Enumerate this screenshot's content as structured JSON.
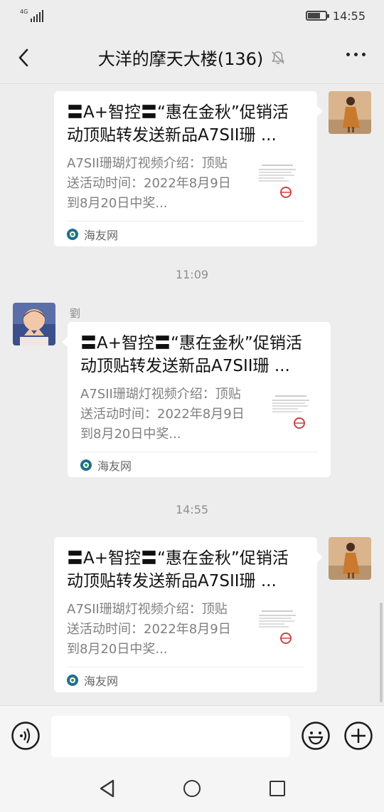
{
  "status": {
    "network": "4G",
    "time": "14:55",
    "battery_level": 0.7
  },
  "header": {
    "title": "大洋的摩天大楼(136)",
    "back_icon": "back-arrow-icon",
    "mute_icon": "bell-muted-icon",
    "more_icon": "more-dots-icon"
  },
  "messages": [
    {
      "side": "right",
      "title": "〓A+智控〓“惠在金秋”促销活动顶贴转发送新品A7SII珊 ...",
      "desc": "A7SII珊瑚灯视频介绍：顶贴送活动时间：2022年8月9日到8月20日中奖...",
      "source": "海友网"
    },
    {
      "side": "left",
      "sender": "劉",
      "title": "〓A+智控〓“惠在金秋”促销活动顶贴转发送新品A7SII珊 ...",
      "desc": "A7SII珊瑚灯视频介绍：顶贴送活动时间：2022年8月9日到8月20日中奖...",
      "source": "海友网"
    },
    {
      "side": "right",
      "title": "〓A+智控〓“惠在金秋”促销活动顶贴转发送新品A7SII珊 ...",
      "desc": "A7SII珊瑚灯视频介绍：顶贴送活动时间：2022年8月9日到8月20日中奖...",
      "source": "海友网"
    }
  ],
  "timestamps": [
    "11:09",
    "14:55"
  ],
  "input": {
    "voice_icon": "voice-icon",
    "emoji_icon": "emoji-icon",
    "plus_icon": "plus-icon",
    "placeholder": ""
  },
  "colors": {
    "background": "#ededed",
    "card": "#ffffff",
    "source_icon": "#1f6e8c"
  }
}
